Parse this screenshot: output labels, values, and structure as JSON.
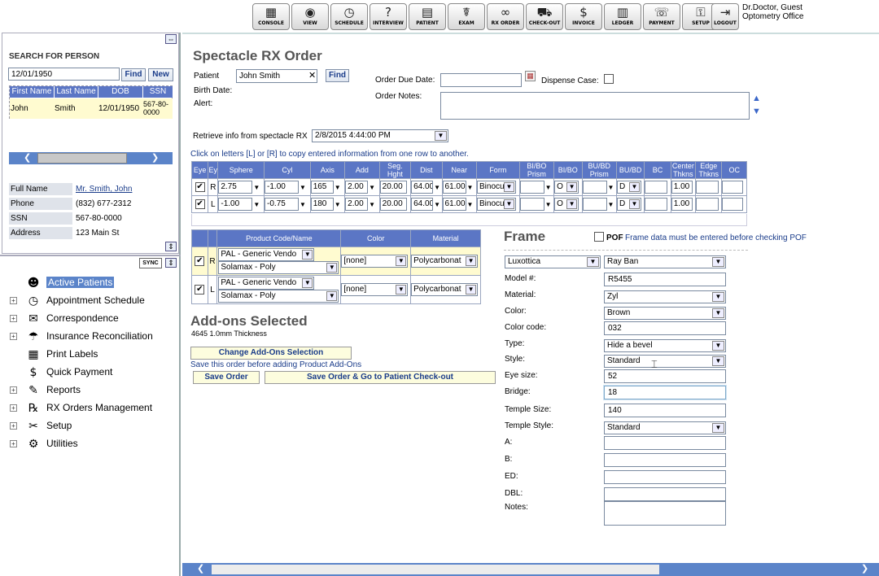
{
  "toolbar": {
    "buttons": [
      {
        "label": "CONSOLE",
        "icon": "console-icon",
        "glyph": "▦"
      },
      {
        "label": "VIEW",
        "icon": "view-icon",
        "glyph": "◉"
      },
      {
        "label": "SCHEDULE",
        "icon": "clock-icon",
        "glyph": "◷"
      },
      {
        "label": "INTERVIEW",
        "icon": "interview-icon",
        "glyph": "?"
      },
      {
        "label": "PATIENT",
        "icon": "patient-icon",
        "glyph": "▤"
      },
      {
        "label": "EXAM",
        "icon": "exam-icon",
        "glyph": "☤"
      },
      {
        "label": "RX ORDER",
        "icon": "glasses-icon",
        "glyph": "∞"
      },
      {
        "label": "CHECK-OUT",
        "icon": "cart-icon",
        "glyph": "⛟"
      },
      {
        "label": "INVOICE",
        "icon": "invoice-icon",
        "glyph": "$"
      },
      {
        "label": "LEDGER",
        "icon": "ledger-icon",
        "glyph": "▥"
      },
      {
        "label": "PAYMENT",
        "icon": "payment-icon",
        "glyph": "☏"
      },
      {
        "label": "SETUP",
        "icon": "key-icon",
        "glyph": "⚿"
      },
      {
        "label": "LOGOUT",
        "icon": "logout-icon",
        "glyph": "⇥"
      }
    ],
    "user": "Dr.Doctor, Guest",
    "office": "Optometry Office"
  },
  "search": {
    "title": "SEARCH FOR PERSON",
    "value": "12/01/1950",
    "find": "Find",
    "new": "New",
    "headers": [
      "First Name",
      "Last Name",
      "DOB",
      "SSN"
    ],
    "row": [
      "John",
      "Smith",
      "12/01/1950",
      "567-80-0000"
    ]
  },
  "person": {
    "full_name_label": "Full Name",
    "full_name": "Mr. Smith, John",
    "phone_label": "Phone",
    "phone": "(832) 677-2312",
    "ssn_label": "SSN",
    "ssn": "567-80-0000",
    "address_label": "Address",
    "address": "123 Main St"
  },
  "sync": "SYNC",
  "tree": [
    {
      "label": "Active Patients",
      "icon": "doctor-icon",
      "glyph": "☻",
      "expand": false,
      "selected": true
    },
    {
      "label": "Appointment Schedule",
      "icon": "schedule-icon",
      "glyph": "◷",
      "expand": true
    },
    {
      "label": "Correspondence",
      "icon": "correspondence-icon",
      "glyph": "✉",
      "expand": true
    },
    {
      "label": "Insurance Reconciliation",
      "icon": "insurance-icon",
      "glyph": "☂",
      "expand": true
    },
    {
      "label": "Print Labels",
      "icon": "labels-icon",
      "glyph": "▦",
      "expand": false
    },
    {
      "label": "Quick Payment",
      "icon": "payment-icon",
      "glyph": "$",
      "expand": false
    },
    {
      "label": "Reports",
      "icon": "reports-icon",
      "glyph": "✎",
      "expand": true
    },
    {
      "label": "RX Orders Management",
      "icon": "rx-icon",
      "glyph": "℞",
      "expand": true
    },
    {
      "label": "Setup",
      "icon": "setup-icon",
      "glyph": "✂",
      "expand": true
    },
    {
      "label": "Utilities",
      "icon": "utilities-icon",
      "glyph": "⚙",
      "expand": true
    }
  ],
  "order": {
    "title": "Spectacle RX Order",
    "patient_label": "Patient",
    "patient": "John Smith",
    "find": "Find",
    "birth_label": "Birth Date:",
    "alert_label": "Alert:",
    "due_label": "Order Due Date:",
    "dispense_label": "Dispense Case:",
    "notes_label": "Order Notes:",
    "retrieve_label": "Retrieve info from spectacle RX",
    "retrieve_value": "2/8/2015 4:44:00 PM",
    "hint": "Click on letters [L] or [R] to copy entered information from one row to another."
  },
  "rx": {
    "headers": [
      "Eye",
      "Ey",
      "Sphere",
      "Cyl",
      "Axis",
      "Add",
      "Seg.\nHght",
      "Dist",
      "Near",
      "Form",
      "BI/BO\nPrism",
      "BI/BO",
      "BU/BD\nPrism",
      "BU/BD",
      "BC",
      "Center\nThkns",
      "Edge\nThkns",
      "OC"
    ],
    "rows": [
      {
        "eye": "R",
        "sphere": "2.75",
        "cyl": "-1.00",
        "axis": "165",
        "add": "2.00",
        "seg": "20.00",
        "dist": "64.00",
        "near": "61.00",
        "form": "Binocu",
        "bibo": "O",
        "bubd": "D",
        "ct": "1.00"
      },
      {
        "eye": "L",
        "sphere": "-1.00",
        "cyl": "-0.75",
        "axis": "180",
        "add": "2.00",
        "seg": "20.00",
        "dist": "64.00",
        "near": "61.00",
        "form": "Binocu",
        "bibo": "O",
        "bubd": "D",
        "ct": "1.00"
      }
    ]
  },
  "lens": {
    "headers": [
      "Product Code/Name",
      "Color",
      "Material"
    ],
    "rows": [
      {
        "eye": "R",
        "code": "PAL - Generic Vendo",
        "product": "Solamax - Poly",
        "color": "[none]",
        "material": "Polycarbonat"
      },
      {
        "eye": "L",
        "code": "PAL - Generic Vendo",
        "product": "Solamax - Poly",
        "color": "[none]",
        "material": "Polycarbonat"
      }
    ]
  },
  "addons": {
    "title": "Add-ons Selected",
    "item": "4645 1.0mm Thickness",
    "change": "Change Add-Ons Selection",
    "note": "Save this order before adding Product Add-Ons",
    "save": "Save Order",
    "save_checkout": "Save Order & Go to Patient Check-out"
  },
  "frame": {
    "title": "Frame",
    "pof": "POF",
    "pof_note": "Frame data must be entered before checking POF",
    "vendor": "Luxottica",
    "brand": "Ray Ban",
    "fields": [
      {
        "label": "Model #:",
        "value": "R5455",
        "type": "text"
      },
      {
        "label": "Material:",
        "value": "Zyl",
        "type": "select"
      },
      {
        "label": "Color:",
        "value": "Brown",
        "type": "select"
      },
      {
        "label": "Color code:",
        "value": "032",
        "type": "text"
      },
      {
        "label": "Type:",
        "value": "Hide a bevel",
        "type": "select"
      },
      {
        "label": "Style:",
        "value": "Standard",
        "type": "select"
      },
      {
        "label": "Eye size:",
        "value": "52",
        "type": "text"
      },
      {
        "label": "Bridge:",
        "value": "18",
        "type": "text"
      },
      {
        "label": "Temple Size:",
        "value": "140",
        "type": "text"
      },
      {
        "label": "Temple Style:",
        "value": "Standard",
        "type": "select"
      },
      {
        "label": "A:",
        "value": "",
        "type": "text"
      },
      {
        "label": "B:",
        "value": "",
        "type": "text"
      },
      {
        "label": "ED:",
        "value": "",
        "type": "text"
      },
      {
        "label": "DBL:",
        "value": "",
        "type": "text"
      },
      {
        "label": "Notes:",
        "value": "",
        "type": "area"
      }
    ]
  },
  "colors": {
    "header_blue": "#5b76c5",
    "selected_row": "#fffbd0",
    "scroll_blue": "#5b84c9"
  }
}
